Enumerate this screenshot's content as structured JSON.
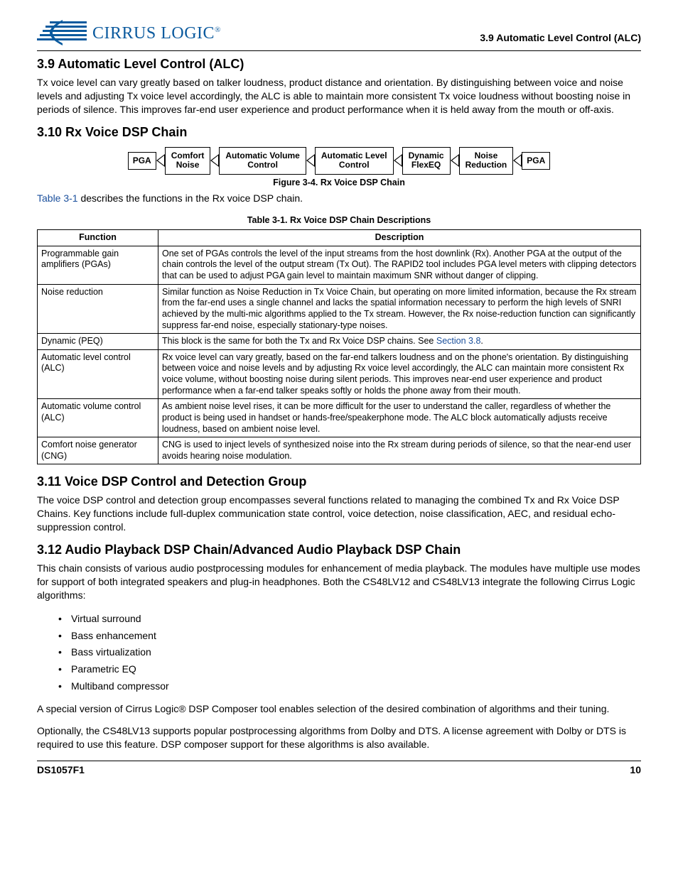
{
  "header": {
    "company_main": "CIRRUS LOGIC",
    "company_mark": "®",
    "section_ref": "3.9 Automatic Level Control (ALC)"
  },
  "sec39": {
    "title": "3.9   Automatic Level Control (ALC)",
    "body": "Tx voice level can vary greatly based on talker loudness, product distance and orientation. By distinguishing between voice and noise levels and adjusting Tx voice level accordingly, the ALC is able to maintain more consistent Tx voice loudness without boosting noise in periods of silence. This improves far-end user experience and product performance when it is held away from the mouth or off-axis."
  },
  "sec310": {
    "title": "3.10 Rx Voice DSP Chain",
    "chain": {
      "b1": "PGA",
      "b2": "Comfort\nNoise",
      "b3": "Automatic Volume\nControl",
      "b4": "Automatic Level\nControl",
      "b5": "Dynamic\nFlexEQ",
      "b6": "Noise\nReduction",
      "b7": "PGA"
    },
    "fig_caption": "Figure 3-4. Rx Voice DSP Chain",
    "intro_link": "Table 3-1",
    "intro_rest": " describes the functions in the Rx voice DSP chain.",
    "tbl_caption": "Table 3-1.  Rx Voice DSP Chain Descriptions",
    "th1": "Function",
    "th2": "Description",
    "rows": [
      {
        "f": "Programmable gain amplifiers (PGAs)",
        "d": "One set of PGAs controls the level of the input streams from the host downlink (Rx). Another PGA at the output of the chain controls the level of the output stream (Tx Out). The RAPID2 tool includes PGA level meters with clipping detectors that can be used to adjust PGA gain level to maintain maximum SNR without danger of clipping."
      },
      {
        "f": "Noise reduction",
        "d": "Similar function as Noise Reduction in Tx Voice Chain, but operating on more limited information, because the Rx stream from the far-end uses a single channel and lacks the spatial information necessary to perform the high levels of SNRI achieved by the multi-mic algorithms applied to the Tx stream. However, the Rx noise-reduction function can significantly suppress far-end noise, especially stationary-type noises."
      },
      {
        "f": "Dynamic (PEQ)",
        "d_pre": "This block is the same for both the Tx and Rx Voice DSP chains. See ",
        "d_link": "Section 3.8",
        "d_post": "."
      },
      {
        "f": "Automatic level control (ALC)",
        "d": "Rx voice level can vary greatly, based on the far-end talkers loudness and on the phone's orientation. By distinguishing between voice and noise levels and by adjusting Rx voice level accordingly, the ALC can maintain more consistent Rx voice volume, without boosting noise during silent periods. This improves near-end user experience and product performance when a far-end talker speaks softly or holds the phone away from their mouth."
      },
      {
        "f": "Automatic volume control (ALC)",
        "d": "As ambient noise level rises, it can be more difficult for the user to understand the caller, regardless of whether the product is being used in handset or hands-free/speakerphone mode. The ALC block automatically adjusts receive loudness, based on ambient noise level."
      },
      {
        "f": "Comfort noise generator (CNG)",
        "d": "CNG is used to inject levels of synthesized noise into the Rx stream during periods of silence, so that the near-end user avoids hearing noise modulation."
      }
    ]
  },
  "sec311": {
    "title": "3.11 Voice DSP Control and Detection Group",
    "body": "The voice DSP control and detection group encompasses several functions related to managing the combined Tx and Rx Voice DSP Chains. Key functions include full-duplex communication state control, voice detection, noise classification, AEC, and residual echo-suppression control."
  },
  "sec312": {
    "title": "3.12 Audio Playback DSP Chain/Advanced Audio Playback DSP Chain",
    "p1": "This chain consists of various audio postprocessing modules for enhancement of media playback. The modules have multiple use modes for support of both integrated speakers and plug-in headphones. Both the CS48LV12 and CS48LV13 integrate the following Cirrus Logic algorithms:",
    "algos": [
      "Virtual surround",
      "Bass enhancement",
      "Bass virtualization",
      "Parametric EQ",
      "Multiband compressor"
    ],
    "p2": "A special version of Cirrus Logic® DSP Composer tool enables selection of the desired combination of algorithms and their tuning.",
    "p3": "Optionally, the CS48LV13 supports popular postprocessing algorithms from Dolby and DTS. A license agreement with Dolby or DTS is required to use this feature. DSP composer support for these algorithms is also available."
  },
  "footer": {
    "left": "DS1057F1",
    "right": "10"
  }
}
